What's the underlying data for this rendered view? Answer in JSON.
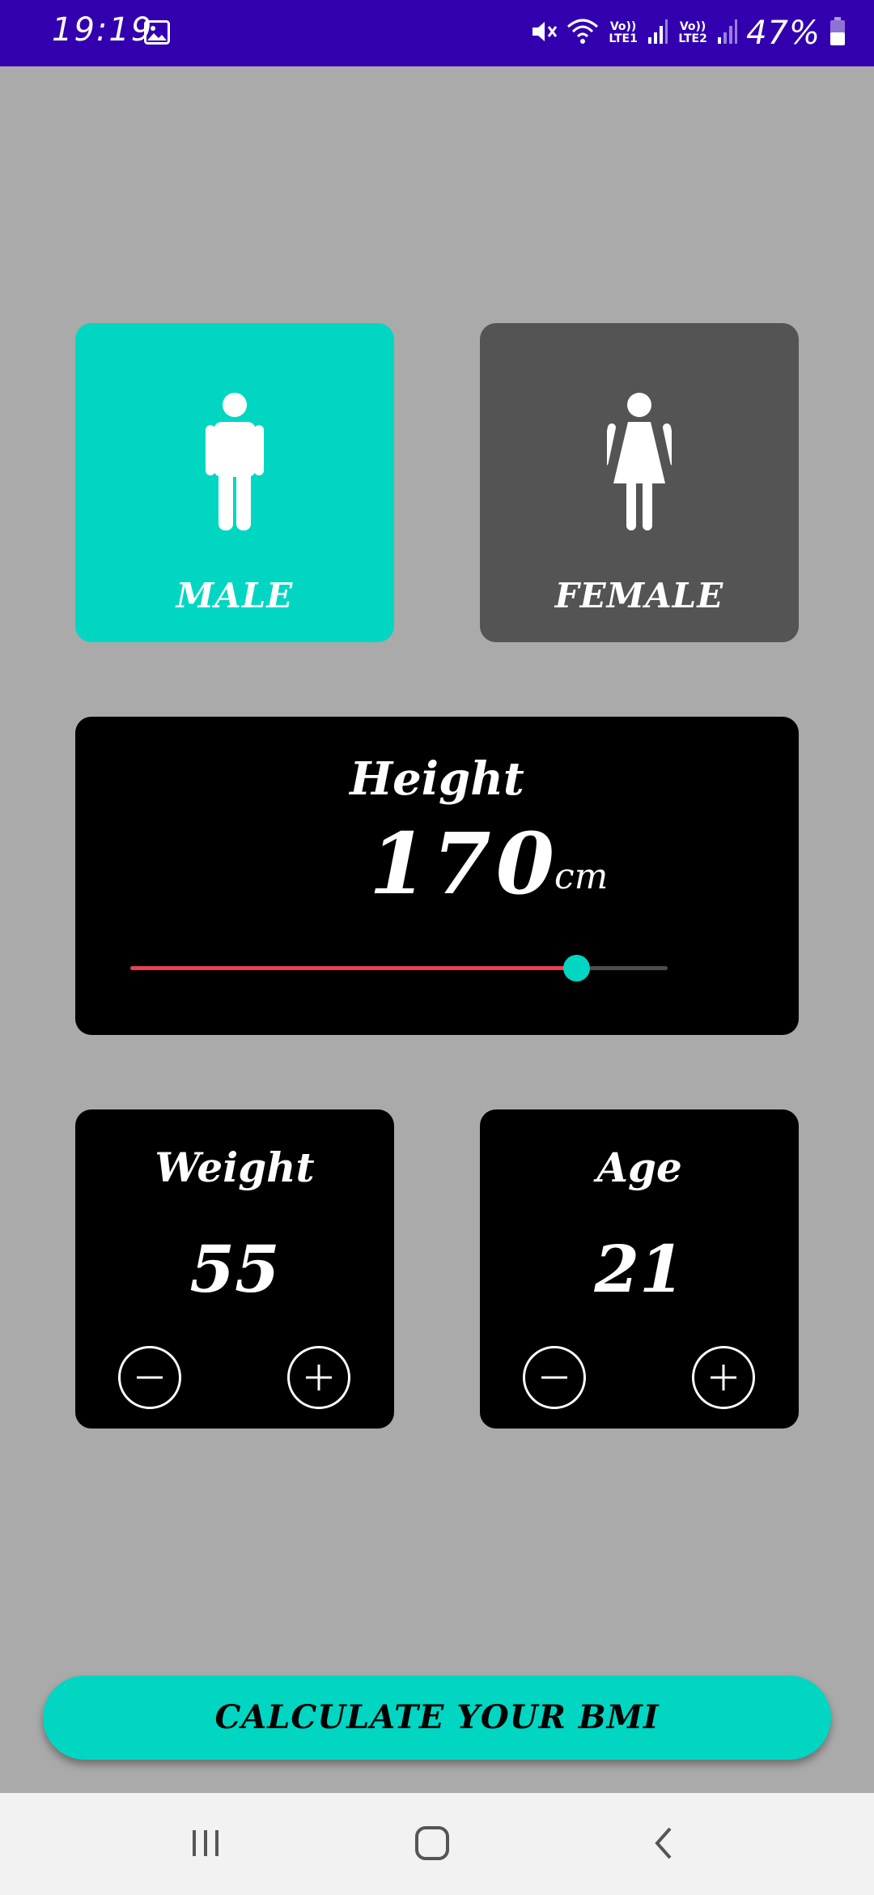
{
  "status_bar": {
    "time": "19:19",
    "lte1": "Vo)) LTE1",
    "lte2": "Vo)) LTE2",
    "battery": "47%",
    "icons": [
      "gallery-icon",
      "mute-icon",
      "wifi-icon",
      "signal-icon",
      "battery-icon"
    ]
  },
  "gender": {
    "male_label": "MALE",
    "female_label": "FEMALE",
    "selected": "MALE"
  },
  "height": {
    "label": "Height",
    "value": "170",
    "unit": "cm",
    "slider_fraction": 0.83
  },
  "weight": {
    "label": "Weight",
    "value": "55"
  },
  "age": {
    "label": "Age",
    "value": "21"
  },
  "calculate": {
    "label": "CALCULATE YOUR BMI"
  },
  "colors": {
    "accent": "#00d6c2",
    "status_bar": "#3300b0",
    "background": "#aaaaaa",
    "card_inactive": "#545454",
    "card_dark": "#000000",
    "slider_active": "#e8414f"
  }
}
